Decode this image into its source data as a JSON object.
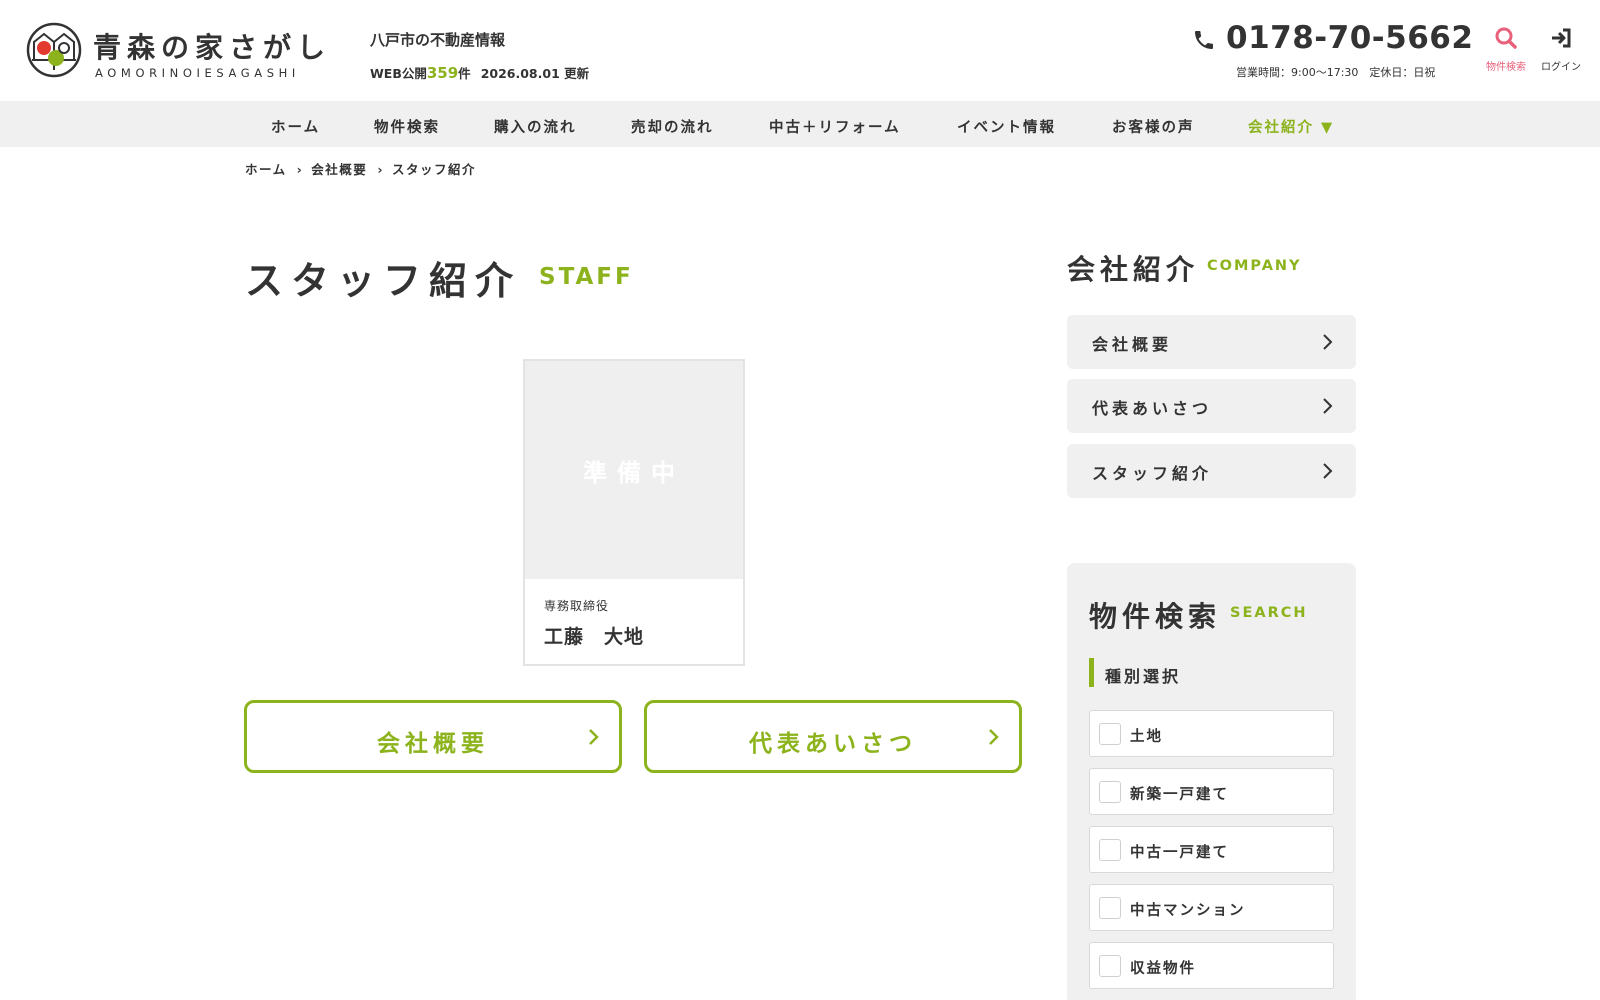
{
  "header": {
    "logo_title": "青森の家さがし",
    "logo_sub": "AOMORINOIESAGASHI",
    "site_desc": "八戸市の不動産情報",
    "stats": {
      "prefix": "WEB公開",
      "count": "359",
      "unit": "件",
      "date": "2026.08.01",
      "updated": "更新"
    },
    "phone": "0178-70-5662",
    "hours": "営業時間：9:00〜17:30　定休日：日祝",
    "search_label": "物件検索",
    "login_label": "ログイン"
  },
  "nav": {
    "items": [
      {
        "label": "ホーム"
      },
      {
        "label": "物件検索"
      },
      {
        "label": "購入の流れ"
      },
      {
        "label": "売却の流れ"
      },
      {
        "label": "中古＋リフォーム"
      },
      {
        "label": "イベント情報"
      },
      {
        "label": "お客様の声"
      },
      {
        "label": "会社紹介 ▼"
      }
    ]
  },
  "breadcrumb": {
    "items": [
      "ホーム",
      "会社概要",
      "スタッフ紹介"
    ]
  },
  "main": {
    "title": "スタッフ紹介",
    "title_en": "STAFF",
    "staff": {
      "photo_placeholder": "準備中",
      "role": "専務取締役",
      "name": "工藤　大地"
    },
    "buttons": {
      "company": "会社概要",
      "greeting": "代表あいさつ"
    }
  },
  "sidebar": {
    "company_title": "会社紹介",
    "company_title_en": "COMPANY",
    "links": [
      "会社概要",
      "代表あいさつ",
      "スタッフ紹介"
    ],
    "search": {
      "title": "物件検索",
      "title_en": "SEARCH",
      "section": "種別選択",
      "options": [
        "土地",
        "新築一戸建て",
        "中古一戸建て",
        "中古マンション",
        "収益物件"
      ]
    }
  },
  "colors": {
    "accent": "#8cb31c",
    "search_icon": "#e8607a",
    "nav_bg": "#f0f0f0"
  }
}
